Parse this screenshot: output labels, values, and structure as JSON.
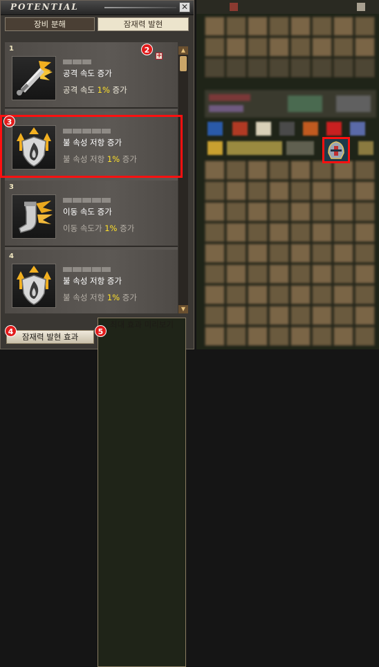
{
  "window": {
    "title": "POTENTIAL",
    "close_label": "✕"
  },
  "tabs": [
    {
      "label": "장비 분해",
      "active": false
    },
    {
      "label": "잠재력 발현",
      "active": true
    }
  ],
  "potentials": [
    {
      "index": "1",
      "icon": "sword-speed-icon",
      "name": "공격 속도 증가",
      "desc_pre": "공격 속도 ",
      "value": "1%",
      "desc_post": " 증가"
    },
    {
      "index": "2",
      "icon": "fire-resist-shield-icon",
      "name": "불 속성 저항 증가",
      "desc_pre": "불 속성 저항 ",
      "value": "1%",
      "desc_post": " 증가"
    },
    {
      "index": "3",
      "icon": "boot-speed-icon",
      "name": "이동 속도 증가",
      "desc_pre": "이동 속도가 ",
      "value": "1%",
      "desc_post": " 증가"
    },
    {
      "index": "4",
      "icon": "fire-resist-shield-icon",
      "name": "불 속성 저항 증가",
      "desc_pre": "불 속성 저항 ",
      "value": "1%",
      "desc_post": " 증가"
    }
  ],
  "footer": {
    "effect_button": "잠재력 발현 효과",
    "preview_button": "최대 효과 미리보기"
  },
  "callouts": [
    "1",
    "2",
    "3",
    "4",
    "5"
  ],
  "colors": {
    "highlight": "#ff1010",
    "value_text": "#ffe12a"
  }
}
